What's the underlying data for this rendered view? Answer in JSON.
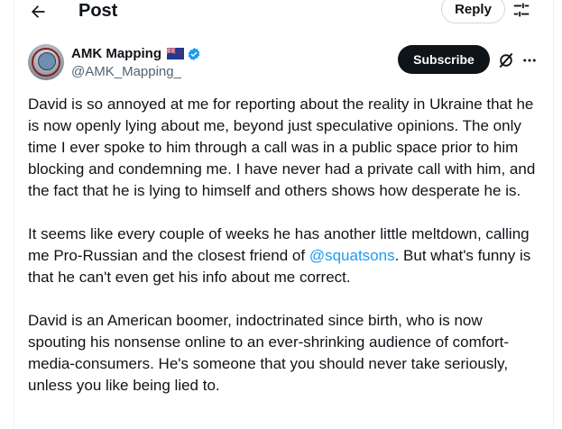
{
  "header": {
    "title": "Post",
    "reply_label": "Reply"
  },
  "author": {
    "name": "AMK Mapping",
    "handle": "@AMK_Mapping_",
    "avatar_text": "AMK Mapping",
    "flag": "new-zealand-flag",
    "verified": true
  },
  "actions": {
    "subscribe_label": "Subscribe"
  },
  "post": {
    "p1": "David is so annoyed at me for reporting about the reality in Ukraine that he is now openly lying about me, beyond just speculative opinions. The only time I ever spoke to him through a call was in a public space prior to him blocking and condemning me. I have never had a private call with him, and the fact that he is lying to himself and others shows how desperate he is.",
    "p2_before": "It seems like every couple of weeks he has another little meltdown, calling me Pro-Russian and the closest friend of ",
    "p2_mention": "@squatsons",
    "p2_after": ". But what's funny is that he can't even get his info about me correct.",
    "p3": "David is an American boomer, indoctrinated since birth, who is now spouting his nonsense online to an ever-shrinking audience of comfort-media-consumers. He's someone that you should never take seriously, unless you like being lied to."
  },
  "colors": {
    "accent": "#1d9bf0",
    "text": "#0f1419",
    "secondary": "#536471"
  },
  "icons": [
    "back-arrow-icon",
    "filter-icon",
    "verified-badge-icon",
    "grok-icon",
    "more-icon",
    "new-zealand-flag"
  ]
}
